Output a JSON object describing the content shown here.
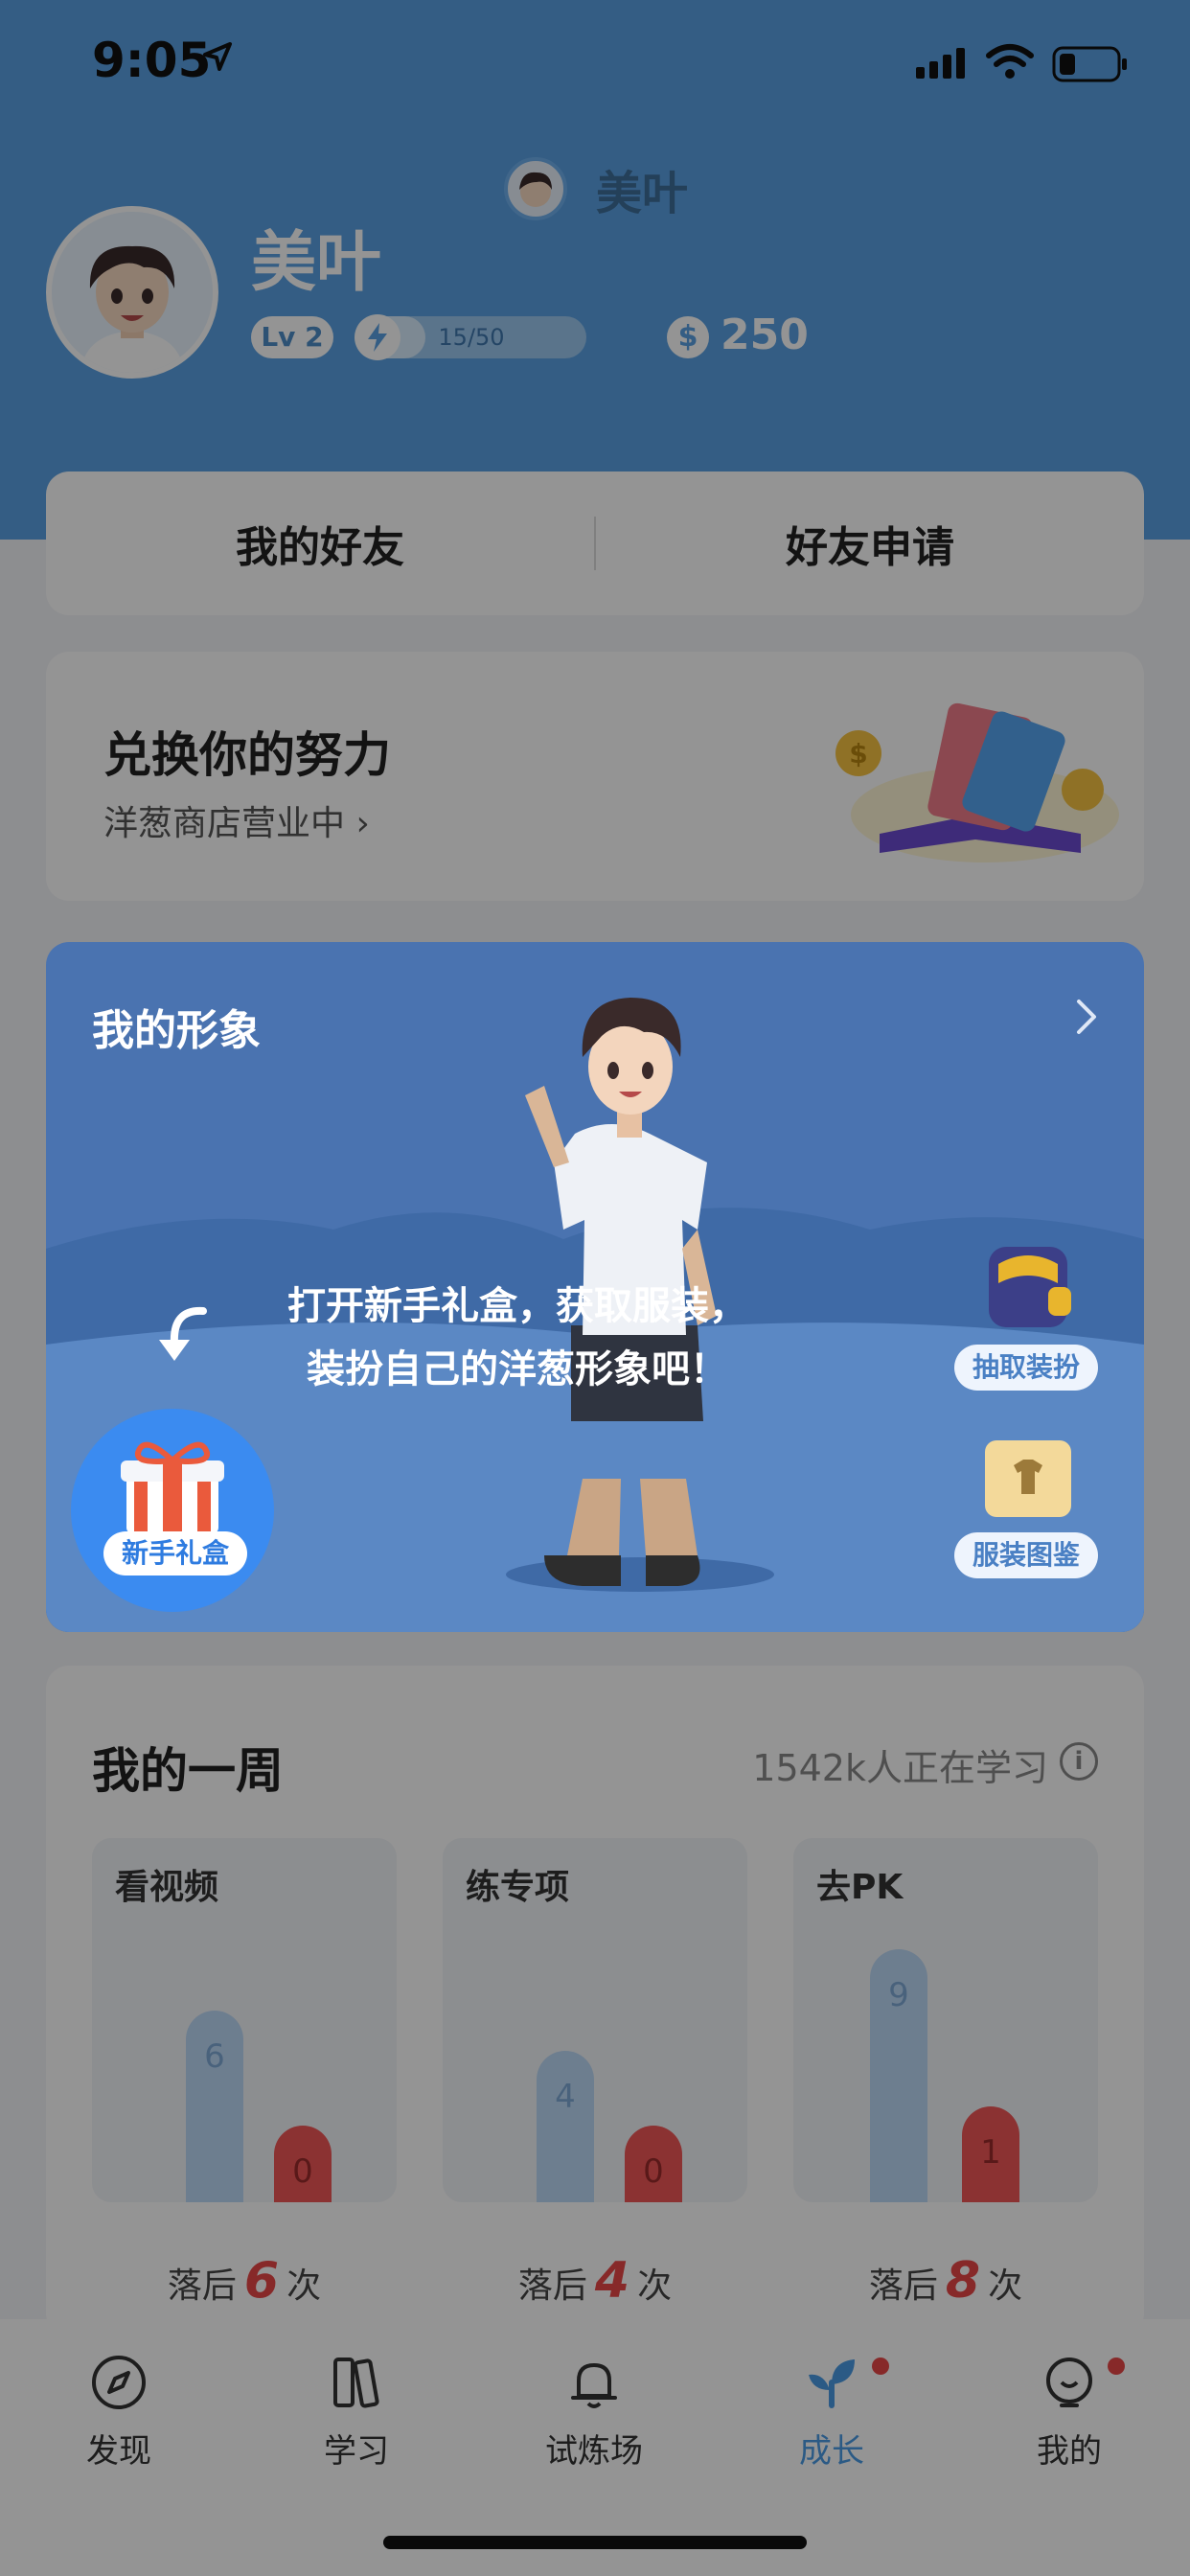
{
  "status_bar": {
    "time": "9:05"
  },
  "header": {
    "mini_name": "美叶",
    "name": "美叶",
    "level": "Lv 2",
    "energy_text": "15/50",
    "energy_fraction": 0.3,
    "coins": "250"
  },
  "tabs": [
    "我的好友",
    "好友申请"
  ],
  "shop": {
    "title": "兑换你的努力",
    "subtitle": "洋葱商店营业中 ›"
  },
  "image_card": {
    "title": "我的形象",
    "tip_line1": "打开新手礼盒，获取服装，",
    "tip_line2": "装扮自己的洋葱形象吧！",
    "draw_btn": "抽取装扮",
    "guide_btn": "服装图鉴",
    "gift_label": "新手礼盒"
  },
  "week": {
    "title": "我的一周",
    "learning_count": "1542k人正在学习",
    "info_glyph": "i",
    "columns": [
      {
        "title": "看视频",
        "me": "6",
        "friend": "0",
        "behind_prefix": "落后",
        "behind_n": "6",
        "behind_suffix": "次"
      },
      {
        "title": "练专项",
        "me": "4",
        "friend": "0",
        "behind_prefix": "落后",
        "behind_n": "4",
        "behind_suffix": "次"
      },
      {
        "title": "去PK",
        "me": "9",
        "friend": "1",
        "behind_prefix": "落后",
        "behind_n": "8",
        "behind_suffix": "次"
      }
    ]
  },
  "tabbar": {
    "items": [
      {
        "label": "发现",
        "icon": "compass-icon"
      },
      {
        "label": "学习",
        "icon": "books-icon"
      },
      {
        "label": "试炼场",
        "icon": "bell-icon"
      },
      {
        "label": "成长",
        "icon": "sprout-icon"
      },
      {
        "label": "我的",
        "icon": "face-icon"
      }
    ],
    "active_index": 3
  },
  "colors": {
    "brand_blue": "#5aa1e3",
    "accent_red": "#e84848",
    "card_blue": "#7aa7e2"
  }
}
